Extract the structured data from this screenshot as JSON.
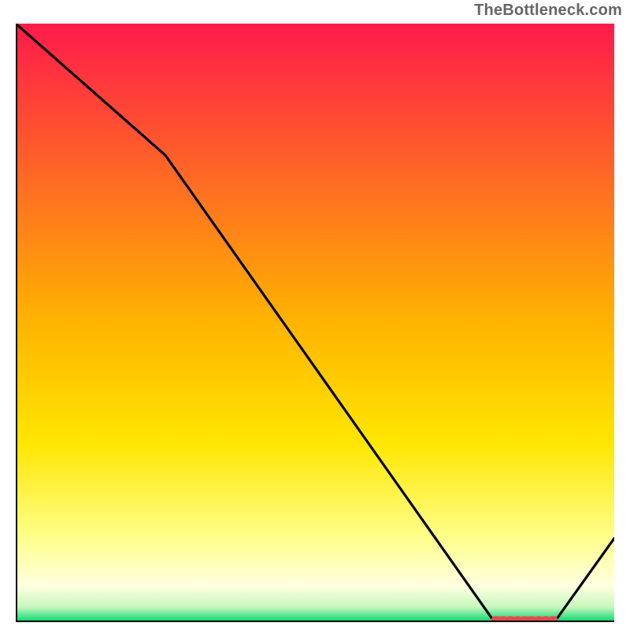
{
  "attribution": "TheBottleneck.com",
  "chart_data": {
    "type": "line",
    "title": "",
    "xlabel": "",
    "ylabel": "",
    "xlim": [
      0,
      100
    ],
    "ylim": [
      0,
      100
    ],
    "note": "Axes have no tick labels; values below are estimated percentages of plot width/height.",
    "series": [
      {
        "name": "curve",
        "x": [
          0,
          25,
          80,
          90,
          100
        ],
        "y": [
          100,
          78,
          0,
          0,
          14
        ]
      }
    ],
    "marker": {
      "name": "optimal-range",
      "x_start": 80,
      "x_end": 90,
      "y": 0
    },
    "background_gradient": {
      "stops": [
        {
          "pos": 0.0,
          "color": "#ff1a4b"
        },
        {
          "pos": 0.5,
          "color": "#ffb400"
        },
        {
          "pos": 0.7,
          "color": "#ffe600"
        },
        {
          "pos": 0.86,
          "color": "#ffff8c"
        },
        {
          "pos": 0.94,
          "color": "#feffe0"
        },
        {
          "pos": 0.975,
          "color": "#c6f7bd"
        },
        {
          "pos": 1.0,
          "color": "#00d66b"
        }
      ]
    },
    "axis_color": "#000000"
  }
}
